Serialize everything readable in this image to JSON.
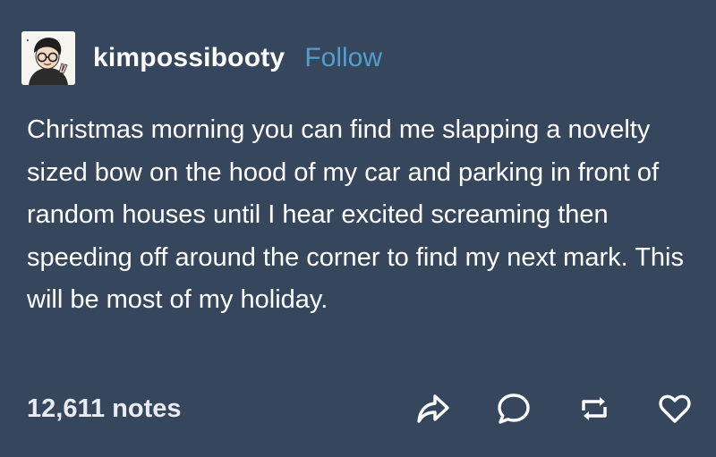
{
  "post": {
    "author": {
      "username": "kimpossibooty",
      "follow_label": "Follow"
    },
    "body": "Christmas morning you can find me slapping a novelty sized bow on the hood of my car and parking in front of random houses until I hear excited screaming then speeding off around the corner to find my next mark. This will be most of my holiday.",
    "notes": "12,611 notes",
    "actions": [
      {
        "name": "share",
        "icon": "share-arrow-icon"
      },
      {
        "name": "reply",
        "icon": "speech-bubble-icon"
      },
      {
        "name": "reblog",
        "icon": "reblog-icon"
      },
      {
        "name": "like",
        "icon": "heart-icon"
      }
    ]
  },
  "colors": {
    "background": "#36465d",
    "text": "#ffffff",
    "follow": "#529ecc"
  }
}
